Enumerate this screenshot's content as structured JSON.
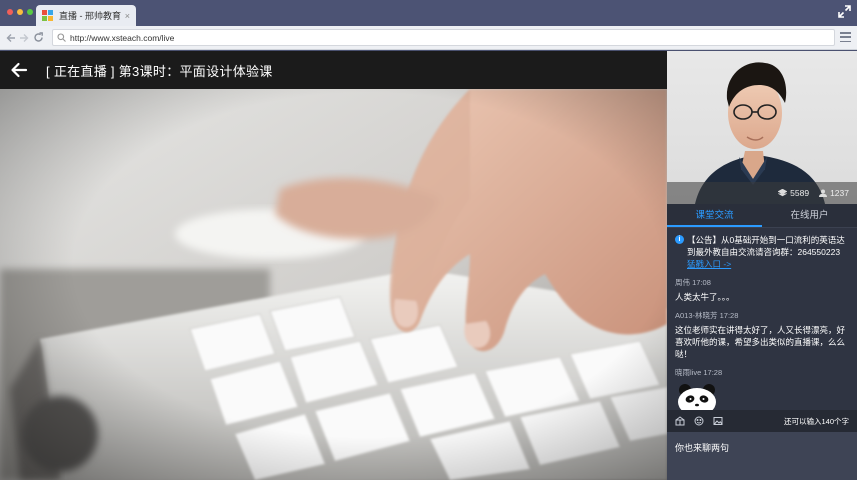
{
  "browser": {
    "tab_title": "直播 - 邢帅教育",
    "tab_close": "×",
    "url": "http://www.xsteach.com/live"
  },
  "video": {
    "title": "[ 正在直播 ] 第3课时：平面设计体验课"
  },
  "side": {
    "stats": {
      "views": "5589",
      "users": "1237"
    },
    "tabs": [
      "课堂交流",
      "在线用户"
    ],
    "notice": {
      "text": "【公告】从0基础开始到一口流利的英语达到最外教自由交流请咨询群：264550223",
      "link": "猛戳入口 ->"
    },
    "messages": [
      {
        "user": "周伟",
        "time": "17:08",
        "text": "人类太牛了。。。"
      },
      {
        "user": "A013-林晓芳",
        "time": "17:28",
        "text": "这位老师实在讲得太好了，人又长得漂亮，好喜欢听他的课，希望多出类似的直播课，么么哒！"
      },
      {
        "user": "晓雨live",
        "time": "17:28",
        "text": ""
      }
    ],
    "remaining": "还可以输入140个字",
    "input_placeholder": "你也来聊两句"
  },
  "icons": {
    "back": "back-arrow-icon",
    "expand": "expand-icon",
    "menu": "menu-icon"
  },
  "colors": {
    "accent": "#2b9bff",
    "panel": "#2f3442",
    "header": "#1b1b1b"
  }
}
